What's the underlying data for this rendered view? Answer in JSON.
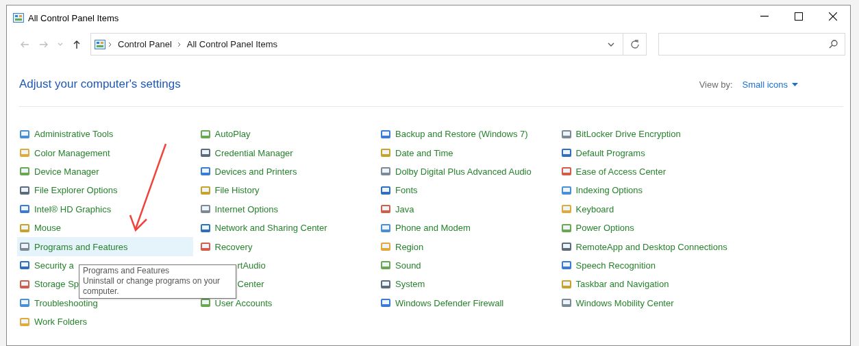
{
  "window": {
    "title": "All Control Panel Items"
  },
  "nav_buttons": [
    {
      "kind": "back",
      "disabled": true
    },
    {
      "kind": "forward",
      "disabled": true
    },
    {
      "kind": "recent",
      "disabled": true
    },
    {
      "kind": "up",
      "disabled": false
    }
  ],
  "address": {
    "crumbs": [
      "Control Panel",
      "All Control Panel Items"
    ]
  },
  "heading": "Adjust your computer's settings",
  "view_by": {
    "label": "View by:",
    "value": "Small icons"
  },
  "columns": [
    [
      {
        "label": "Administrative Tools",
        "hovered": false
      },
      {
        "label": "Color Management",
        "hovered": false
      },
      {
        "label": "Device Manager",
        "hovered": false
      },
      {
        "label": "File Explorer Options",
        "hovered": false
      },
      {
        "label": "Intel® HD Graphics",
        "hovered": false
      },
      {
        "label": "Mouse",
        "hovered": false
      },
      {
        "label": "Programs and Features",
        "hovered": true
      },
      {
        "label": "Security a",
        "hovered": false
      },
      {
        "label": "Storage Sp",
        "hovered": false
      },
      {
        "label": "Troubleshooting",
        "hovered": false
      },
      {
        "label": "Work Folders",
        "hovered": false
      }
    ],
    [
      {
        "label": "AutoPlay",
        "hovered": false
      },
      {
        "label": "Credential Manager",
        "hovered": false
      },
      {
        "label": "Devices and Printers",
        "hovered": false
      },
      {
        "label": "File History",
        "hovered": false
      },
      {
        "label": "Internet Options",
        "hovered": false
      },
      {
        "label": "Network and Sharing Center",
        "hovered": false
      },
      {
        "label": "Recovery",
        "hovered": false
      },
      {
        "label": "rtAudio",
        "hovered": false,
        "covered": true
      },
      {
        "label": "Center",
        "hovered": false,
        "covered": true
      },
      {
        "label": "User Accounts",
        "hovered": false
      }
    ],
    [
      {
        "label": "Backup and Restore (Windows 7)",
        "hovered": false
      },
      {
        "label": "Date and Time",
        "hovered": false
      },
      {
        "label": "Dolby Digital Plus Advanced Audio",
        "hovered": false
      },
      {
        "label": "Fonts",
        "hovered": false
      },
      {
        "label": "Java",
        "hovered": false
      },
      {
        "label": "Phone and Modem",
        "hovered": false
      },
      {
        "label": "Region",
        "hovered": false
      },
      {
        "label": "Sound",
        "hovered": false
      },
      {
        "label": "System",
        "hovered": false
      },
      {
        "label": "Windows Defender Firewall",
        "hovered": false
      }
    ],
    [
      {
        "label": "BitLocker Drive Encryption",
        "hovered": false
      },
      {
        "label": "Default Programs",
        "hovered": false
      },
      {
        "label": "Ease of Access Center",
        "hovered": false
      },
      {
        "label": "Indexing Options",
        "hovered": false
      },
      {
        "label": "Keyboard",
        "hovered": false
      },
      {
        "label": "Power Options",
        "hovered": false
      },
      {
        "label": "RemoteApp and Desktop Connections",
        "hovered": false
      },
      {
        "label": "Speech Recognition",
        "hovered": false
      },
      {
        "label": "Taskbar and Navigation",
        "hovered": false
      },
      {
        "label": "Windows Mobility Center",
        "hovered": false
      }
    ]
  ],
  "tooltip": {
    "title": "Programs and Features",
    "text": "Uninstall or change programs on your computer."
  }
}
